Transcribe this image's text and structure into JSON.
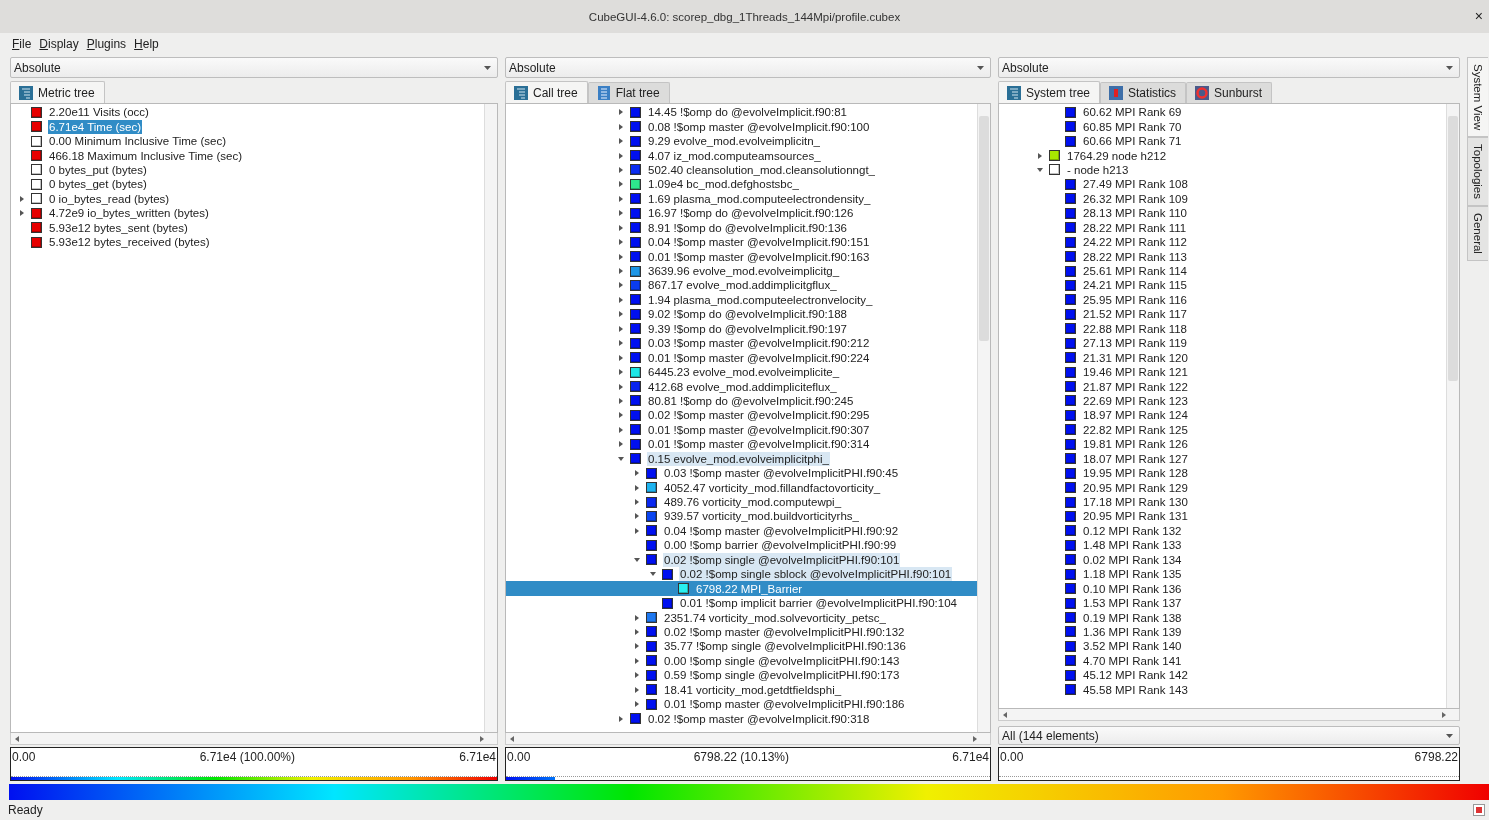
{
  "window": {
    "title": "CubeGUI-4.6.0: scorep_dbg_1Threads_144Mpi/profile.cubex",
    "close": "×"
  },
  "menu": [
    "File",
    "Display",
    "Plugins",
    "Help"
  ],
  "metric_panel": {
    "dropdown": "Absolute",
    "tabs": [
      {
        "label": "Metric tree",
        "selected": true
      }
    ],
    "items": [
      {
        "text": "2.20e11 Visits (occ)",
        "color": "#e60000",
        "selected": false
      },
      {
        "text": "6.71e4 Time (sec)",
        "color": "#e60000",
        "selected": true
      },
      {
        "text": "0.00 Minimum Inclusive Time (sec)",
        "color": "#ffffff",
        "selected": false
      },
      {
        "text": "466.18 Maximum Inclusive Time (sec)",
        "color": "#e60000",
        "selected": false
      },
      {
        "text": "0 bytes_put (bytes)",
        "color": "#ffffff",
        "selected": false
      },
      {
        "text": "0 bytes_get (bytes)",
        "color": "#ffffff",
        "selected": false
      },
      {
        "text": "0 io_bytes_read (bytes)",
        "color": "#ffffff",
        "expanded": false,
        "selected": false
      },
      {
        "text": "4.72e9 io_bytes_written (bytes)",
        "color": "#e60000",
        "expanded": false,
        "selected": false
      },
      {
        "text": "5.93e12 bytes_sent (bytes)",
        "color": "#e60000",
        "selected": false
      },
      {
        "text": "5.93e12 bytes_received (bytes)",
        "color": "#e60000",
        "selected": false
      }
    ],
    "value_bar": {
      "min": "0.00",
      "value": "6.71e4 (100.00%)",
      "max": "6.71e4",
      "level": 1
    }
  },
  "call_panel": {
    "dropdown": "Absolute",
    "tabs": [
      {
        "label": "Call tree",
        "selected": true
      },
      {
        "label": "Flat tree",
        "selected": false
      }
    ],
    "items": [
      {
        "text": "14.45 !$omp do @evolveImplicit.f90:81",
        "color": "#0010f0",
        "expanded": false,
        "selected": false,
        "on_path": false
      },
      {
        "text": "0.08 !$omp master @evolveImplicit.f90:100",
        "color": "#0010f0",
        "expanded": false,
        "selected": false,
        "on_path": false
      },
      {
        "text": "9.29 evolve_mod.evolveimplicitn_",
        "color": "#0010f0",
        "expanded": false,
        "selected": false,
        "on_path": false
      },
      {
        "text": "4.07 iz_mod.computeamsources_",
        "color": "#0010f0",
        "expanded": false,
        "selected": false,
        "on_path": false
      },
      {
        "text": "502.40 cleansolution_mod.cleansolutionngt_",
        "color": "#0a2cf0",
        "expanded": false,
        "selected": false,
        "on_path": false
      },
      {
        "text": "1.09e4 bc_mod.defghostsbc_",
        "color": "#2ee68c",
        "expanded": false,
        "selected": false,
        "on_path": false
      },
      {
        "text": "1.69 plasma_mod.computeelectrondensity_",
        "color": "#0010f0",
        "expanded": false,
        "selected": false,
        "on_path": false
      },
      {
        "text": "16.97 !$omp do @evolveImplicit.f90:126",
        "color": "#0010f0",
        "expanded": false,
        "selected": false,
        "on_path": false
      },
      {
        "text": "8.91 !$omp do @evolveImplicit.f90:136",
        "color": "#0010f0",
        "expanded": false,
        "selected": false,
        "on_path": false
      },
      {
        "text": "0.04 !$omp master @evolveImplicit.f90:151",
        "color": "#0010f0",
        "expanded": false,
        "selected": false,
        "on_path": false
      },
      {
        "text": "0.01 !$omp master @evolveImplicit.f90:163",
        "color": "#0010f0",
        "expanded": false,
        "selected": false,
        "on_path": false
      },
      {
        "text": "3639.96 evolve_mod.evolveimplicitg_",
        "color": "#1e96e6",
        "expanded": false,
        "selected": false,
        "on_path": false
      },
      {
        "text": "867.17 evolve_mod.addimplicitgflux_",
        "color": "#0a3cf0",
        "expanded": false,
        "selected": false,
        "on_path": false
      },
      {
        "text": "1.94 plasma_mod.computeelectronvelocity_",
        "color": "#0010f0",
        "expanded": false,
        "selected": false,
        "on_path": false
      },
      {
        "text": "9.02 !$omp do @evolveImplicit.f90:188",
        "color": "#0010f0",
        "expanded": false,
        "selected": false,
        "on_path": false
      },
      {
        "text": "9.39 !$omp do @evolveImplicit.f90:197",
        "color": "#0010f0",
        "expanded": false,
        "selected": false,
        "on_path": false
      },
      {
        "text": "0.03 !$omp master @evolveImplicit.f90:212",
        "color": "#0010f0",
        "expanded": false,
        "selected": false,
        "on_path": false
      },
      {
        "text": "0.01 !$omp master @evolveImplicit.f90:224",
        "color": "#0010f0",
        "expanded": false,
        "selected": false,
        "on_path": false
      },
      {
        "text": "6445.23 evolve_mod.evolveimplicite_",
        "color": "#1ee6e6",
        "expanded": false,
        "selected": false,
        "on_path": false
      },
      {
        "text": "412.68 evolve_mod.addimpliciteflux_",
        "color": "#0a24f0",
        "expanded": false,
        "selected": false,
        "on_path": false
      },
      {
        "text": "80.81 !$omp do @evolveImplicit.f90:245",
        "color": "#0010f0",
        "expanded": false,
        "selected": false,
        "on_path": false
      },
      {
        "text": "0.02 !$omp master @evolveImplicit.f90:295",
        "color": "#0010f0",
        "expanded": false,
        "selected": false,
        "on_path": false
      },
      {
        "text": "0.01 !$omp master @evolveImplicit.f90:307",
        "color": "#0010f0",
        "expanded": false,
        "selected": false,
        "on_path": false
      },
      {
        "text": "0.01 !$omp master @evolveImplicit.f90:314",
        "color": "#0010f0",
        "expanded": false,
        "selected": false,
        "on_path": false
      },
      {
        "text": "0.15 evolve_mod.evolveimplicitphi_",
        "color": "#0010f0",
        "expanded": true,
        "selected": false,
        "on_path": true,
        "children": [
          {
            "text": "0.03 !$omp master @evolveImplicitPHI.f90:45",
            "color": "#0010f0",
            "expanded": false,
            "selected": false,
            "on_path": false
          },
          {
            "text": "4052.47 vorticity_mod.fillandfactovorticity_",
            "color": "#1eb4f0",
            "expanded": false,
            "selected": false,
            "on_path": false
          },
          {
            "text": "489.76 vorticity_mod.computewpi_",
            "color": "#0a28f0",
            "expanded": false,
            "selected": false,
            "on_path": false
          },
          {
            "text": "939.57 vorticity_mod.buildvorticityrhs_",
            "color": "#0a44f0",
            "expanded": false,
            "selected": false,
            "on_path": false
          },
          {
            "text": "0.04 !$omp master @evolveImplicitPHI.f90:92",
            "color": "#0010f0",
            "expanded": false,
            "selected": false,
            "on_path": false
          },
          {
            "text": "0.00 !$omp barrier @evolveImplicitPHI.f90:99",
            "color": "#0010f0",
            "selected": false,
            "on_path": false
          },
          {
            "text": "0.02 !$omp single @evolveImplicitPHI.f90:101",
            "color": "#0010f0",
            "expanded": true,
            "selected": false,
            "on_path": true,
            "children": [
              {
                "text": "0.02 !$omp single sblock @evolveImplicitPHI.f90:101",
                "color": "#0010f0",
                "expanded": true,
                "selected": false,
                "on_path": true,
                "children": [
                  {
                    "text": "6798.22 MPI_Barrier",
                    "color": "#28f0f0",
                    "selected": true
                  }
                ]
              },
              {
                "text": "0.01 !$omp implicit barrier @evolveImplicitPHI.f90:104",
                "color": "#0010f0",
                "selected": false,
                "on_path": false
              }
            ]
          },
          {
            "text": "2351.74 vorticity_mod.solvevorticity_petsc_",
            "color": "#1e78f0",
            "expanded": false,
            "selected": false,
            "on_path": false
          },
          {
            "text": "0.02 !$omp master @evolveImplicitPHI.f90:132",
            "color": "#0010f0",
            "expanded": false,
            "selected": false,
            "on_path": false
          },
          {
            "text": "35.77 !$omp single @evolveImplicitPHI.f90:136",
            "color": "#0010f0",
            "expanded": false,
            "selected": false,
            "on_path": false
          },
          {
            "text": "0.00 !$omp single @evolveImplicitPHI.f90:143",
            "color": "#0010f0",
            "expanded": false,
            "selected": false,
            "on_path": false
          },
          {
            "text": "0.59 !$omp single @evolveImplicitPHI.f90:173",
            "color": "#0010f0",
            "expanded": false,
            "selected": false,
            "on_path": false
          },
          {
            "text": "18.41 vorticity_mod.getdtfieldsphi_",
            "color": "#0010f0",
            "expanded": false,
            "selected": false,
            "on_path": false
          },
          {
            "text": "0.01 !$omp master @evolveImplicitPHI.f90:186",
            "color": "#0010f0",
            "expanded": false,
            "selected": false,
            "on_path": false
          }
        ]
      },
      {
        "text": "0.02 !$omp master @evolveImplicit.f90:318",
        "color": "#0010f0",
        "expanded": false,
        "selected": false,
        "on_path": false
      }
    ],
    "value_bar": {
      "min": "0.00",
      "value": "6798.22 (10.13%)",
      "max": "6.71e4",
      "level": 0.1013
    }
  },
  "system_panel": {
    "dropdown": "Absolute",
    "tabs": [
      {
        "label": "System tree",
        "selected": true
      },
      {
        "label": "Statistics",
        "selected": false
      },
      {
        "label": "Sunburst",
        "selected": false
      }
    ],
    "partial_children": [
      {
        "text": "60.62 MPI Rank 69",
        "color": "#0010f0",
        "selected": false
      },
      {
        "text": "60.85 MPI Rank 70",
        "color": "#0010f0",
        "selected": false
      },
      {
        "text": "60.66 MPI Rank 71",
        "color": "#0010f0",
        "selected": false
      }
    ],
    "items": [
      {
        "text": "1764.29 node h212",
        "color": "#a8e600",
        "expanded": false,
        "selected": false
      },
      {
        "text": "- node h213",
        "color": "#ffffff",
        "expanded": true,
        "selected": false,
        "children": [
          {
            "text": "27.49 MPI Rank 108",
            "color": "#0010f0",
            "selected": false
          },
          {
            "text": "26.32 MPI Rank 109",
            "color": "#0010f0",
            "selected": false
          },
          {
            "text": "28.13 MPI Rank 110",
            "color": "#0010f0",
            "selected": false
          },
          {
            "text": "28.22 MPI Rank 111",
            "color": "#0010f0",
            "selected": false
          },
          {
            "text": "24.22 MPI Rank 112",
            "color": "#0010f0",
            "selected": false
          },
          {
            "text": "28.22 MPI Rank 113",
            "color": "#0010f0",
            "selected": false
          },
          {
            "text": "25.61 MPI Rank 114",
            "color": "#0010f0",
            "selected": false
          },
          {
            "text": "24.21 MPI Rank 115",
            "color": "#0010f0",
            "selected": false
          },
          {
            "text": "25.95 MPI Rank 116",
            "color": "#0010f0",
            "selected": false
          },
          {
            "text": "21.52 MPI Rank 117",
            "color": "#0010f0",
            "selected": false
          },
          {
            "text": "22.88 MPI Rank 118",
            "color": "#0010f0",
            "selected": false
          },
          {
            "text": "27.13 MPI Rank 119",
            "color": "#0010f0",
            "selected": false
          },
          {
            "text": "21.31 MPI Rank 120",
            "color": "#0010f0",
            "selected": false
          },
          {
            "text": "19.46 MPI Rank 121",
            "color": "#0010f0",
            "selected": false
          },
          {
            "text": "21.87 MPI Rank 122",
            "color": "#0010f0",
            "selected": false
          },
          {
            "text": "22.69 MPI Rank 123",
            "color": "#0010f0",
            "selected": false
          },
          {
            "text": "18.97 MPI Rank 124",
            "color": "#0010f0",
            "selected": false
          },
          {
            "text": "22.82 MPI Rank 125",
            "color": "#0010f0",
            "selected": false
          },
          {
            "text": "19.81 MPI Rank 126",
            "color": "#0010f0",
            "selected": false
          },
          {
            "text": "18.07 MPI Rank 127",
            "color": "#0010f0",
            "selected": false
          },
          {
            "text": "19.95 MPI Rank 128",
            "color": "#0010f0",
            "selected": false
          },
          {
            "text": "20.95 MPI Rank 129",
            "color": "#0010f0",
            "selected": false
          },
          {
            "text": "17.18 MPI Rank 130",
            "color": "#0010f0",
            "selected": false
          },
          {
            "text": "20.95 MPI Rank 131",
            "color": "#0010f0",
            "selected": false
          },
          {
            "text": "0.12 MPI Rank 132",
            "color": "#0010f0",
            "selected": false
          },
          {
            "text": "1.48 MPI Rank 133",
            "color": "#0010f0",
            "selected": false
          },
          {
            "text": "0.02 MPI Rank 134",
            "color": "#0010f0",
            "selected": false
          },
          {
            "text": "1.18 MPI Rank 135",
            "color": "#0010f0",
            "selected": false
          },
          {
            "text": "0.10 MPI Rank 136",
            "color": "#0010f0",
            "selected": false
          },
          {
            "text": "1.53 MPI Rank 137",
            "color": "#0010f0",
            "selected": false
          },
          {
            "text": "0.19 MPI Rank 138",
            "color": "#0010f0",
            "selected": false
          },
          {
            "text": "1.36 MPI Rank 139",
            "color": "#0010f0",
            "selected": false
          },
          {
            "text": "3.52 MPI Rank 140",
            "color": "#0010f0",
            "selected": false
          },
          {
            "text": "4.70 MPI Rank 141",
            "color": "#0010f0",
            "selected": false
          },
          {
            "text": "45.12 MPI Rank 142",
            "color": "#0010f0",
            "selected": false
          },
          {
            "text": "45.58 MPI Rank 143",
            "color": "#0010f0",
            "selected": false
          }
        ]
      }
    ],
    "filter": "All (144 elements)",
    "value_bar": {
      "min": "0.00",
      "max": "6798.22"
    }
  },
  "side_tabs": [
    {
      "label": "System View",
      "selected": true
    },
    {
      "label": "Topologies",
      "selected": false
    },
    {
      "label": "General",
      "selected": false
    }
  ],
  "status_bar": "Ready"
}
